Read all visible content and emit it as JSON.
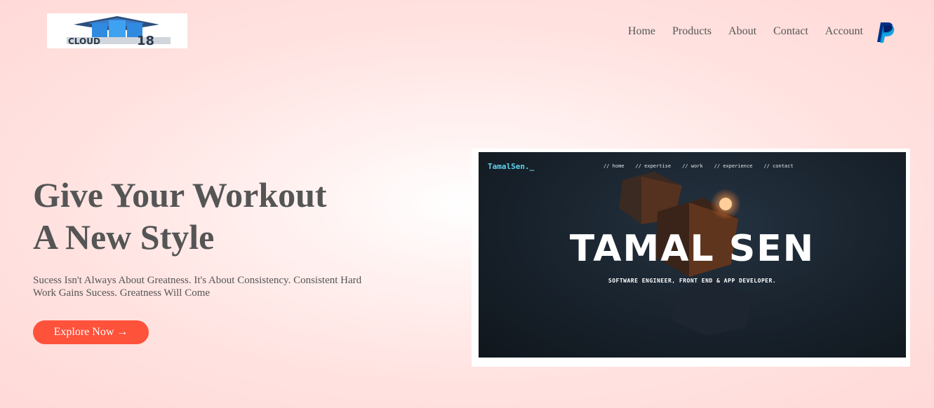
{
  "brand": {
    "logo_text": "CLOUD18"
  },
  "nav": {
    "items": [
      {
        "label": "Home"
      },
      {
        "label": "Products"
      },
      {
        "label": "About"
      },
      {
        "label": "Contact"
      },
      {
        "label": "Account"
      }
    ],
    "payment_icon": "paypal-icon"
  },
  "hero": {
    "title_line1": "Give Your Workout",
    "title_line2": "A New Style",
    "subtitle": "Sucess Isn't Always About Greatness. It's About Consistency. Consistent Hard Work Gains Sucess. Greatness Will Come",
    "cta_label": "Explore Now →"
  },
  "preview": {
    "brand": "TamalSen._",
    "nav_items": [
      "// home",
      "// expertise",
      "// work",
      "// experience",
      "// contact"
    ],
    "name": "TAMAL SEN",
    "tagline": "SOFTWARE ENGINEER, FRONT END & APP DEVELOPER."
  },
  "colors": {
    "accent": "#ff523b",
    "text": "#555555",
    "preview_bg": "#18222c",
    "preview_brand": "#5fd3ee"
  }
}
